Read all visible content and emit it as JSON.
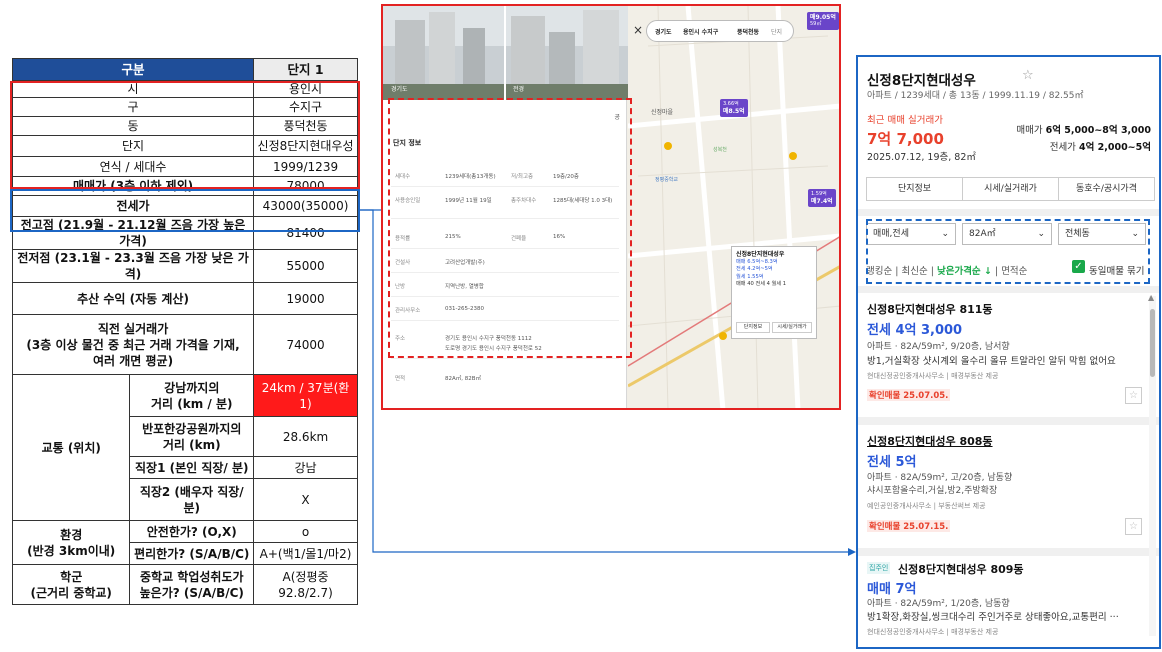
{
  "table": {
    "header": {
      "label": "구분",
      "col": "단지 1"
    },
    "rows": [
      {
        "label": "시",
        "value": "용인시"
      },
      {
        "label": "구",
        "value": "수지구"
      },
      {
        "label": "동",
        "value": "풍덕천동"
      },
      {
        "label": "단지",
        "value": "신정8단지현대우성"
      },
      {
        "label": "연식 / 세대수",
        "value": "1999/1239"
      },
      {
        "label": "매매가 (3층 이하 제외)",
        "value": "78000"
      },
      {
        "label": "전세가",
        "value": "43000(35000)"
      },
      {
        "label": "전고점 (21.9월 - 21.12월 즈음 가장 높은 가격)",
        "value": "81400"
      },
      {
        "label": "전저점 (23.1월 - 23.3월 즈음 가장 낮은 가격)",
        "value": "55000"
      },
      {
        "label": "추산 수익 (자동 계산)",
        "value": "19000"
      },
      {
        "label_lines": [
          "직전 실거래가",
          "(3층 이상 물건 중 최근 거래 가격을 기재,",
          "여러 개면 평균)"
        ],
        "value": "74000"
      }
    ],
    "transport": {
      "group": "교통 (위치)",
      "rows": [
        {
          "label_lines": [
            "강남까지의",
            "거리 (km / 분)"
          ],
          "value": "24km / 37분(환1)"
        },
        {
          "label_lines": [
            "반포한강공원까지의",
            "거리 (km)"
          ],
          "value": "28.6km"
        },
        {
          "label": "직장1 (본인 직장/ 분)",
          "value": "강남"
        },
        {
          "label_lines": [
            "직장2 (배우자 직장/",
            "분)"
          ],
          "value": "X"
        }
      ]
    },
    "env": {
      "group_lines": [
        "환경",
        "(반경 3km이내)"
      ],
      "rows": [
        {
          "label": "안전한가? (O,X)",
          "value": "o"
        },
        {
          "label": "편리한가? (S/A/B/C)",
          "value": "A+(백1/몰1/마2)"
        }
      ]
    },
    "school": {
      "group_lines": [
        "학군",
        "(근거리 중학교)"
      ],
      "row": {
        "label_lines": [
          "중학교 학업성취도가",
          "높은가? (S/A/B/C)"
        ],
        "value": "A(정평중92.8/2.7)"
      }
    }
  },
  "map": {
    "photo_labels": [
      "경기도",
      "전경"
    ],
    "share": "공",
    "info_title": "단지 정보",
    "info_rows": [
      {
        "k": "세대수",
        "v": "1239세대(총13개동)",
        "k2": "저/최고층",
        "v2": "19층/20층"
      },
      {
        "k": "사용승인일",
        "v": "1999년 11월 19일",
        "k2": "총주차대수",
        "v2": "1285대(세대당 1.0 3대)"
      },
      {
        "k": "용적률",
        "v": "215%",
        "k2": "건폐율",
        "v2": "16%"
      },
      {
        "k": "건설사",
        "v": "고려산업개발(주)"
      },
      {
        "k": "난방",
        "v": "지역난방, 열병합"
      },
      {
        "k": "관리사무소",
        "v": "031-265-2380"
      },
      {
        "k": "주소",
        "v": "경기도 용인시 수지구 풍덕천동 1112",
        "v_extra": "도로명 경기도 용인시 수지구 풍덕천로 52"
      },
      {
        "k": "면적",
        "v": "82A㎡, 82B㎡"
      }
    ],
    "breadcrumb": [
      "경기도",
      "용인시 수지구",
      "풍덕천동",
      "단지"
    ],
    "close": "×",
    "markers": [
      {
        "top": "매9.05억",
        "sub": "59㎡"
      },
      {
        "top": "매8.5억",
        "sub": "3.66억"
      },
      {
        "top": "매7.4억",
        "sub": "1.59억"
      }
    ],
    "place_labels": [
      "신정마을",
      "정평중학교",
      "성복천"
    ],
    "popup": {
      "title": "신정8단지현대성우",
      "lines": [
        "매매 6.5억~8.3억",
        "전세 4.2억~5억",
        "월세 1.55억"
      ],
      "counts": "매매 40  전세 4  월세 1",
      "buttons": [
        "단지정보",
        "시세/실거래가"
      ]
    }
  },
  "listing": {
    "title": "신정8단지현대성우",
    "subtitle": "아파트 / 1239세대 / 총 13동 / 1999.11.19 / 82.55㎡",
    "recent_label": "최근 매매 실거래가",
    "recent_price": "7억 7,000",
    "recent_date": "2025.07.12, 19층, 82㎡",
    "sale_range_label": "매매가",
    "sale_range": "6억 5,000~8억 3,000",
    "jeonse_range_label": "전세가",
    "jeonse_range": "4억 2,000~5억",
    "tabs": [
      "단지정보",
      "시세/실거래가",
      "동호수/공시가격"
    ],
    "filters": [
      "매매,전세",
      "82A㎡",
      "전체동"
    ],
    "sort": {
      "a": "랭킹순",
      "b": "최신순",
      "active": "낮은가격순 ↓",
      "c": "면적순"
    },
    "checkbox_label": "동일매물 묶기",
    "items": [
      {
        "name": "신정8단지현대성우 811동",
        "price": "전세 4억 3,000",
        "desc": "아파트 · 82A/59m², 9/20층, 남서향",
        "detail": "방1,거실확장 샷시계외 올수리 올뮤 트알라인 알뒤 막힘 없어요",
        "agent": "현대신정공인중개사사무소 | 매경부동산 제공",
        "confirmed": "확인매물 25.07.05."
      },
      {
        "name": "신정8단지현대성우 808동",
        "price": "전세 5억",
        "desc": "아파트 · 82A/59m², 고/20층, 남동향",
        "detail": "샤시포함올수리,거실,방2,주방확장",
        "agent": "예인공인중개사사무소 | 부동산써브 제공",
        "confirmed": "확인매물 25.07.15."
      },
      {
        "tag": "집주인",
        "name": "신정8단지현대성우 809동",
        "price": "매매 7억",
        "desc": "아파트 · 82A/59m², 1/20층, 남동향",
        "detail": "방1확장,화장실,씽크대수리 주인거주로 상태좋아요,교통편리 ···",
        "agent": "현대신정공인중개사사무소 | 매경부동산 제공"
      }
    ]
  },
  "colors": {
    "red": "#e32222",
    "blue": "#1c66c4",
    "header": "#1f4e99",
    "green": "#19a84a"
  }
}
